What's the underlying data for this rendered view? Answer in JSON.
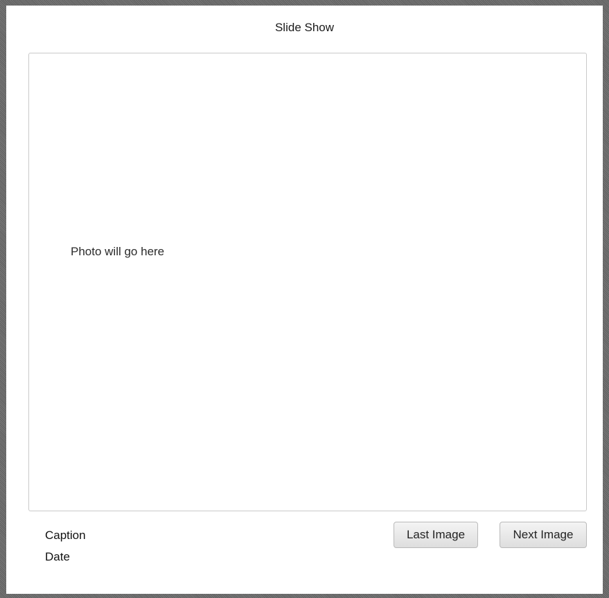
{
  "window": {
    "title": "Slide Show"
  },
  "photo": {
    "placeholder": "Photo will go here"
  },
  "info": {
    "caption": "Caption",
    "date": "Date"
  },
  "controls": {
    "last_label": "Last Image",
    "next_label": "Next Image"
  }
}
